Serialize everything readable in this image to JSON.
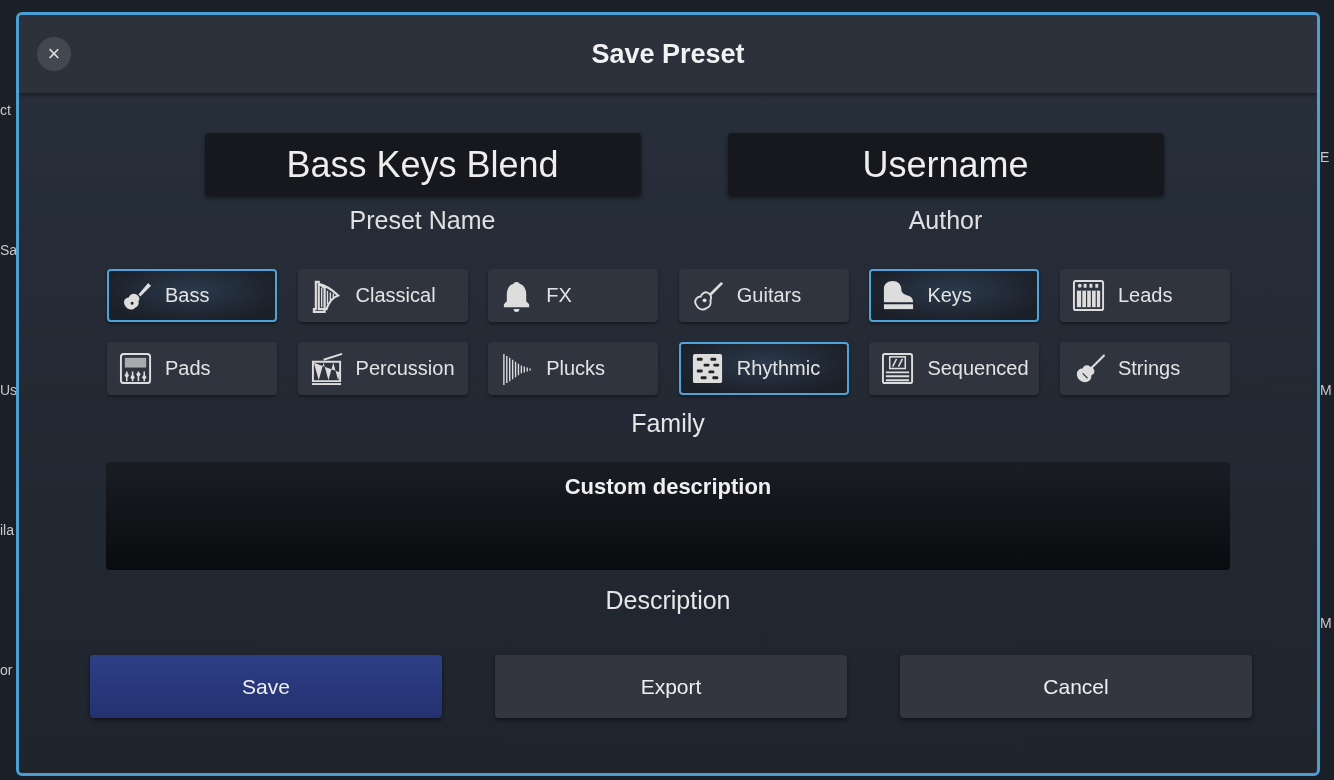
{
  "backdrop": {
    "left_fragments": [
      "ct",
      "Sa",
      "Us",
      "ila",
      "or"
    ],
    "right_fragments": [
      "E",
      "M",
      "M"
    ]
  },
  "dialog": {
    "title": "Save Preset",
    "close": "×"
  },
  "fields": [
    {
      "label": "Preset Name",
      "value": "Bass Keys Blend"
    },
    {
      "label": "Author",
      "value": "Username"
    }
  ],
  "family": {
    "label": "Family",
    "items": [
      {
        "name": "Bass",
        "kind": "bass",
        "selected": true
      },
      {
        "name": "Classical",
        "kind": "harp",
        "selected": false
      },
      {
        "name": "FX",
        "kind": "bell",
        "selected": false
      },
      {
        "name": "Guitars",
        "kind": "guitar",
        "selected": false
      },
      {
        "name": "Keys",
        "kind": "piano",
        "selected": true
      },
      {
        "name": "Leads",
        "kind": "synth",
        "selected": false
      },
      {
        "name": "Pads",
        "kind": "mixer",
        "selected": false
      },
      {
        "name": "Percussion",
        "kind": "drum",
        "selected": false
      },
      {
        "name": "Plucks",
        "kind": "decay",
        "selected": false
      },
      {
        "name": "Rhythmic",
        "kind": "pattern",
        "selected": true
      },
      {
        "name": "Sequenced",
        "kind": "sequencer",
        "selected": false
      },
      {
        "name": "Strings",
        "kind": "violin",
        "selected": false
      }
    ]
  },
  "description": {
    "label": "Description",
    "value": "Custom description"
  },
  "buttons": [
    {
      "label": "Save",
      "kind": "primary"
    },
    {
      "label": "Export",
      "kind": "normal"
    },
    {
      "label": "Cancel",
      "kind": "normal"
    }
  ]
}
